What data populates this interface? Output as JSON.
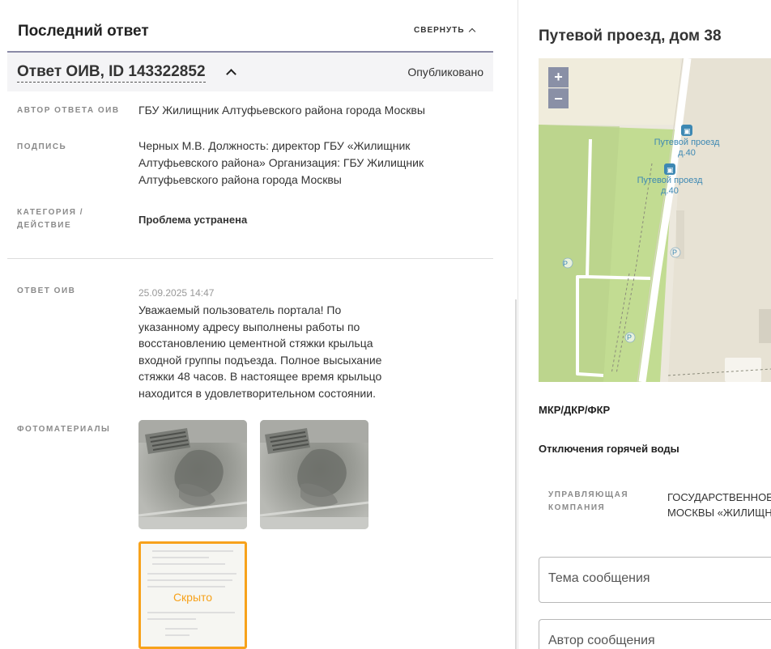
{
  "last_answer": {
    "title": "Последний ответ",
    "collapse_label": "СВЕРНУТЬ"
  },
  "answer": {
    "id_title": "Ответ ОИВ, ID 143322852",
    "status": "Опубликовано",
    "author_label": "АВТОР ОТВЕТА ОИВ",
    "author_value": "ГБУ Жилищник Алтуфьевского района города Москвы",
    "signature_label": "ПОДПИСЬ",
    "signature_value": [
      "Черных М.В. Должность: директор ГБУ «Жилищник",
      "Алтуфьевского района» Организация: ГБУ Жилищник",
      "Алтуфьевского района города Москвы"
    ],
    "category_label": [
      "КАТЕГОРИЯ /",
      "ДЕЙСТВИЕ"
    ],
    "category_value": "Проблема устранена",
    "reply_label": "ОТВЕТ ОИВ",
    "reply_date": "25.09.2025 14:47",
    "reply_text": "Уважаемый пользователь портала! По указанному адресу выполнены работы по восстановлению цементной стяжки крыльца входной группы подъезда. Полное высыхание стяжки 48 часов. В настоящее время крыльцо находится в удовлетворительном состоянии.",
    "photos_label": "ФОТОМАТЕРИАЛЫ",
    "hidden_label": "Скрыто"
  },
  "right": {
    "address_title": "Путевой проезд, дом 38",
    "zoom_in": "+",
    "zoom_out": "−",
    "map_labels": [
      "Путевой проезд",
      "д.40",
      "Путевой проезд",
      "д.40"
    ],
    "parking": "P",
    "section_mkr": "МКР/ДКР/ФКР",
    "section_hot_water": "Отключения горячей воды",
    "uk_label": [
      "УПРАВЛЯЮЩАЯ",
      "КОМПАНИЯ"
    ],
    "uk_value": [
      "ГОСУДАРСТВЕННОЕ",
      "МОСКВЫ «ЖИЛИЩН"
    ],
    "topic_placeholder": "Тема сообщения",
    "author_placeholder": "Автор сообщения"
  },
  "colors": {
    "accent_orange": "#f7a21b",
    "header_border": "#8a8aa6",
    "map_label": "#3d88b3",
    "park_green": "#c2dc92"
  }
}
